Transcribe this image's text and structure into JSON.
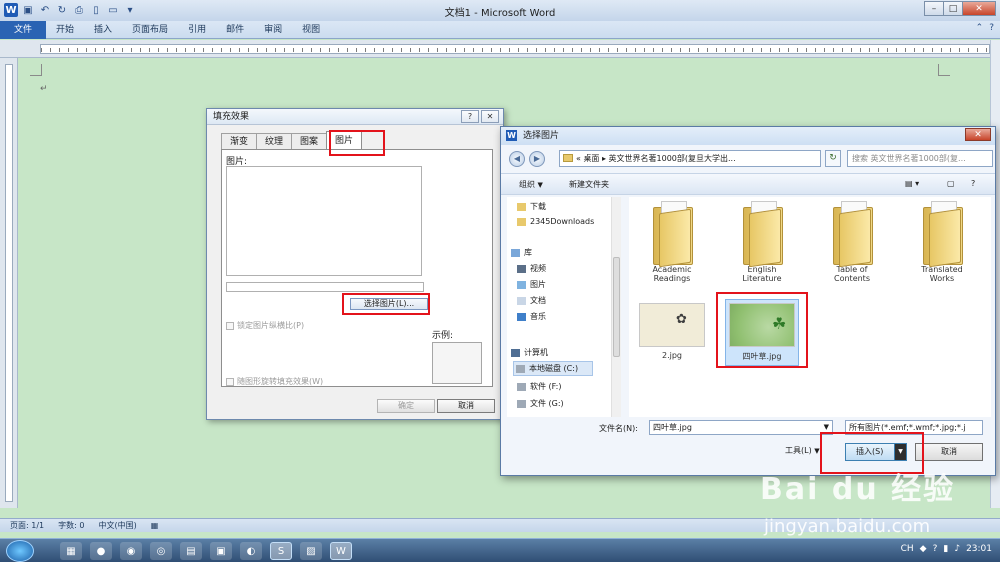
{
  "window": {
    "title": "文档1 - Microsoft Word"
  },
  "ribbon": {
    "tabs": [
      "文件",
      "开始",
      "插入",
      "页面布局",
      "引用",
      "邮件",
      "审阅",
      "视图"
    ]
  },
  "statusbar": {
    "page": "页面: 1/1",
    "words": "字数: 0",
    "language": "中文(中国)"
  },
  "fill_dialog": {
    "title": "填充效果",
    "help": "?",
    "close": "✕",
    "tabs": [
      "渐变",
      "纹理",
      "图案",
      "图片"
    ],
    "picture_label": "图片:",
    "select_button": "选择图片(L)...",
    "lock_aspect": "锁定图片纵横比(P)",
    "rotate_with_shape": "随图形旋转填充效果(W)",
    "sample_label": "示例:",
    "ok": "确定",
    "cancel": "取消"
  },
  "insert_dialog": {
    "title": "选择图片",
    "address": "« 桌面 ▸ 英文世界名著1000部(复旦大学出...",
    "search_placeholder": "搜索 英文世界名著1000部(复...",
    "organize": "组织",
    "new_folder": "新建文件夹",
    "nav": [
      {
        "label": "下载"
      },
      {
        "label": "2345Downloads"
      },
      {
        "label": "库"
      },
      {
        "label": "视频"
      },
      {
        "label": "图片"
      },
      {
        "label": "文档"
      },
      {
        "label": "音乐"
      },
      {
        "label": "计算机"
      },
      {
        "label": "本地磁盘 (C:)"
      },
      {
        "label": "软件 (F:)"
      },
      {
        "label": "文件 (G:)"
      }
    ],
    "folders": [
      {
        "line1": "Academic",
        "line2": "Readings"
      },
      {
        "line1": "English",
        "line2": "Literature"
      },
      {
        "line1": "Table of",
        "line2": "Contents"
      },
      {
        "line1": "Translated",
        "line2": "Works"
      }
    ],
    "images": [
      {
        "name": "2.jpg"
      },
      {
        "name": "四叶草.jpg"
      }
    ],
    "filename_label": "文件名(N):",
    "filename_value": "四叶草.jpg",
    "filetype_value": "所有图片(*.emf;*.wmf;*.jpg;*.j",
    "tools": "工具(L)",
    "insert": "插入(S)",
    "cancel": "取消"
  },
  "taskbar": {
    "lang": "CH",
    "time": "23:01"
  },
  "watermark": {
    "brand": "Bai du 经验",
    "url": "jingyan.baidu.com"
  }
}
